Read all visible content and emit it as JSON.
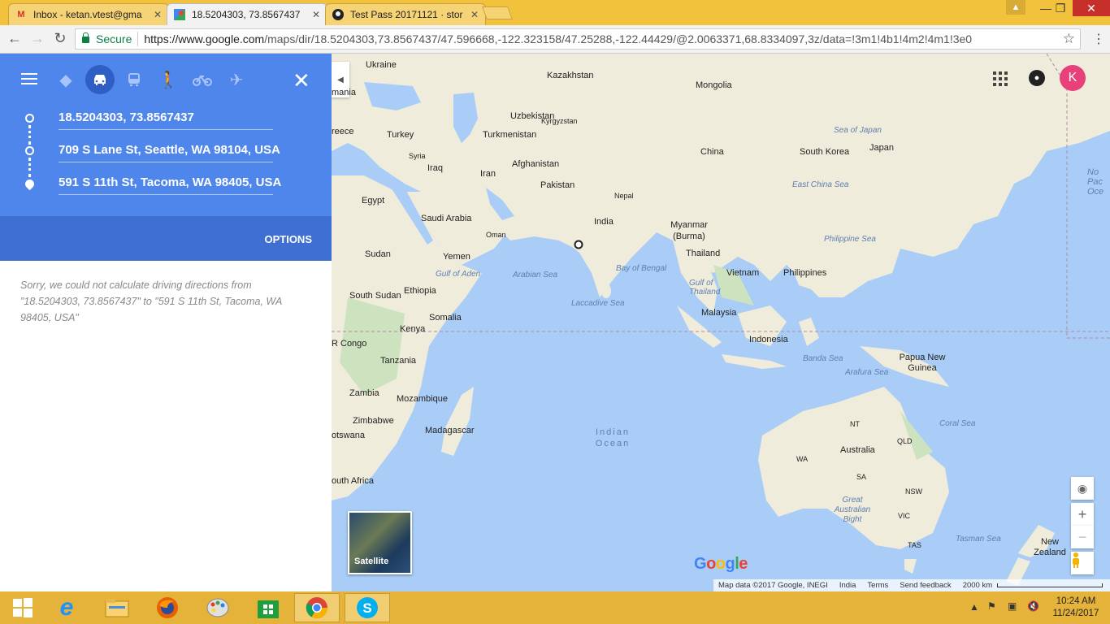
{
  "browser": {
    "tabs": [
      {
        "title": "Inbox - ketan.vtest@gma",
        "icon": "gmail-icon",
        "active": false
      },
      {
        "title": "18.5204303, 73.8567437",
        "icon": "google-maps-icon",
        "active": true
      },
      {
        "title": "Test Pass 20171121 · stor",
        "icon": "github-icon",
        "active": false
      }
    ],
    "secure_label": "Secure",
    "url_host": "https://www.google.com",
    "url_path": "/maps/dir/18.5204303,73.8567437/47.596668,-122.323158/47.25288,-122.44429/@2.0063371,68.8334097,3z/data=!3m1!4b1!4m2!4m1!3e0",
    "user_initial": "",
    "close_symbol": "✕"
  },
  "directions": {
    "modes": [
      "best-route-icon",
      "car-icon",
      "transit-icon",
      "walk-icon",
      "bicycle-icon",
      "flight-icon"
    ],
    "selected_mode": "car-icon",
    "waypoints": [
      "18.5204303, 73.8567437",
      "709 S Lane St, Seattle, WA 98104, USA",
      "591 S 11th St, Tacoma, WA 98405, USA"
    ],
    "options_label": "OPTIONS",
    "error_message": "Sorry, we could not calculate driving directions from \"18.5204303, 73.8567437\" to \"591 S 11th St, Tacoma, WA 98405, USA\""
  },
  "map": {
    "countries": [
      {
        "name": "Ukraine"
      },
      {
        "name": "Kazakhstan"
      },
      {
        "name": "Mongolia"
      },
      {
        "name": "Uzbekistan"
      },
      {
        "name": "Kyrgyzstan"
      },
      {
        "name": "Turkey"
      },
      {
        "name": "Turkmenistan"
      },
      {
        "name": "China"
      },
      {
        "name": "South Korea"
      },
      {
        "name": "Japan"
      },
      {
        "name": "Syria"
      },
      {
        "name": "Iraq"
      },
      {
        "name": "Iran"
      },
      {
        "name": "Afghanistan"
      },
      {
        "name": "Pakistan"
      },
      {
        "name": "Nepal"
      },
      {
        "name": "Egypt"
      },
      {
        "name": "Saudi Arabia"
      },
      {
        "name": "Oman"
      },
      {
        "name": "India"
      },
      {
        "name": "Myanmar (Burma)"
      },
      {
        "name": "Thailand"
      },
      {
        "name": "Vietnam"
      },
      {
        "name": "Philippines"
      },
      {
        "name": "Sudan"
      },
      {
        "name": "Yemen"
      },
      {
        "name": "Ethiopia"
      },
      {
        "name": "South Sudan"
      },
      {
        "name": "Somalia"
      },
      {
        "name": "Malaysia"
      },
      {
        "name": "Kenya"
      },
      {
        "name": "R Congo"
      },
      {
        "name": "Indonesia"
      },
      {
        "name": "Papua New Guinea"
      },
      {
        "name": "Tanzania"
      },
      {
        "name": "Zambia"
      },
      {
        "name": "Mozambique"
      },
      {
        "name": "Zimbabwe"
      },
      {
        "name": "Madagascar"
      },
      {
        "name": "otswana"
      },
      {
        "name": "Australia"
      },
      {
        "name": "outh Africa"
      },
      {
        "name": "New Zealand"
      },
      {
        "name": "reece"
      },
      {
        "name": "mania"
      }
    ],
    "seas": [
      "Sea of Japan",
      "East China Sea",
      "Philippine Sea",
      "Arabian Sea",
      "Bay of Bengal",
      "Gulf of Aden",
      "Gulf of Thailand",
      "Laccadive Sea",
      "Banda Sea",
      "Arafura Sea",
      "Coral Sea",
      "Indian Ocean",
      "Great Australian Bight",
      "Tasman Sea",
      "No Pac Oce"
    ],
    "regions": [
      "NT",
      "QLD",
      "WA",
      "SA",
      "NSW",
      "VIC",
      "TAS"
    ],
    "satellite_label": "Satellite",
    "logo": "Google",
    "footer": {
      "attribution": "Map data ©2017 Google, INEGI",
      "region": "India",
      "terms": "Terms",
      "feedback": "Send feedback",
      "scale": "2000 km"
    },
    "zoom_in": "+",
    "zoom_out": "−"
  },
  "taskbar": {
    "apps": [
      "windows-start-icon",
      "internet-explorer-icon",
      "file-explorer-icon",
      "firefox-icon",
      "paint-icon",
      "store-icon",
      "chrome-icon",
      "skype-icon"
    ],
    "time": "10:24 AM",
    "date": "11/24/2017"
  }
}
